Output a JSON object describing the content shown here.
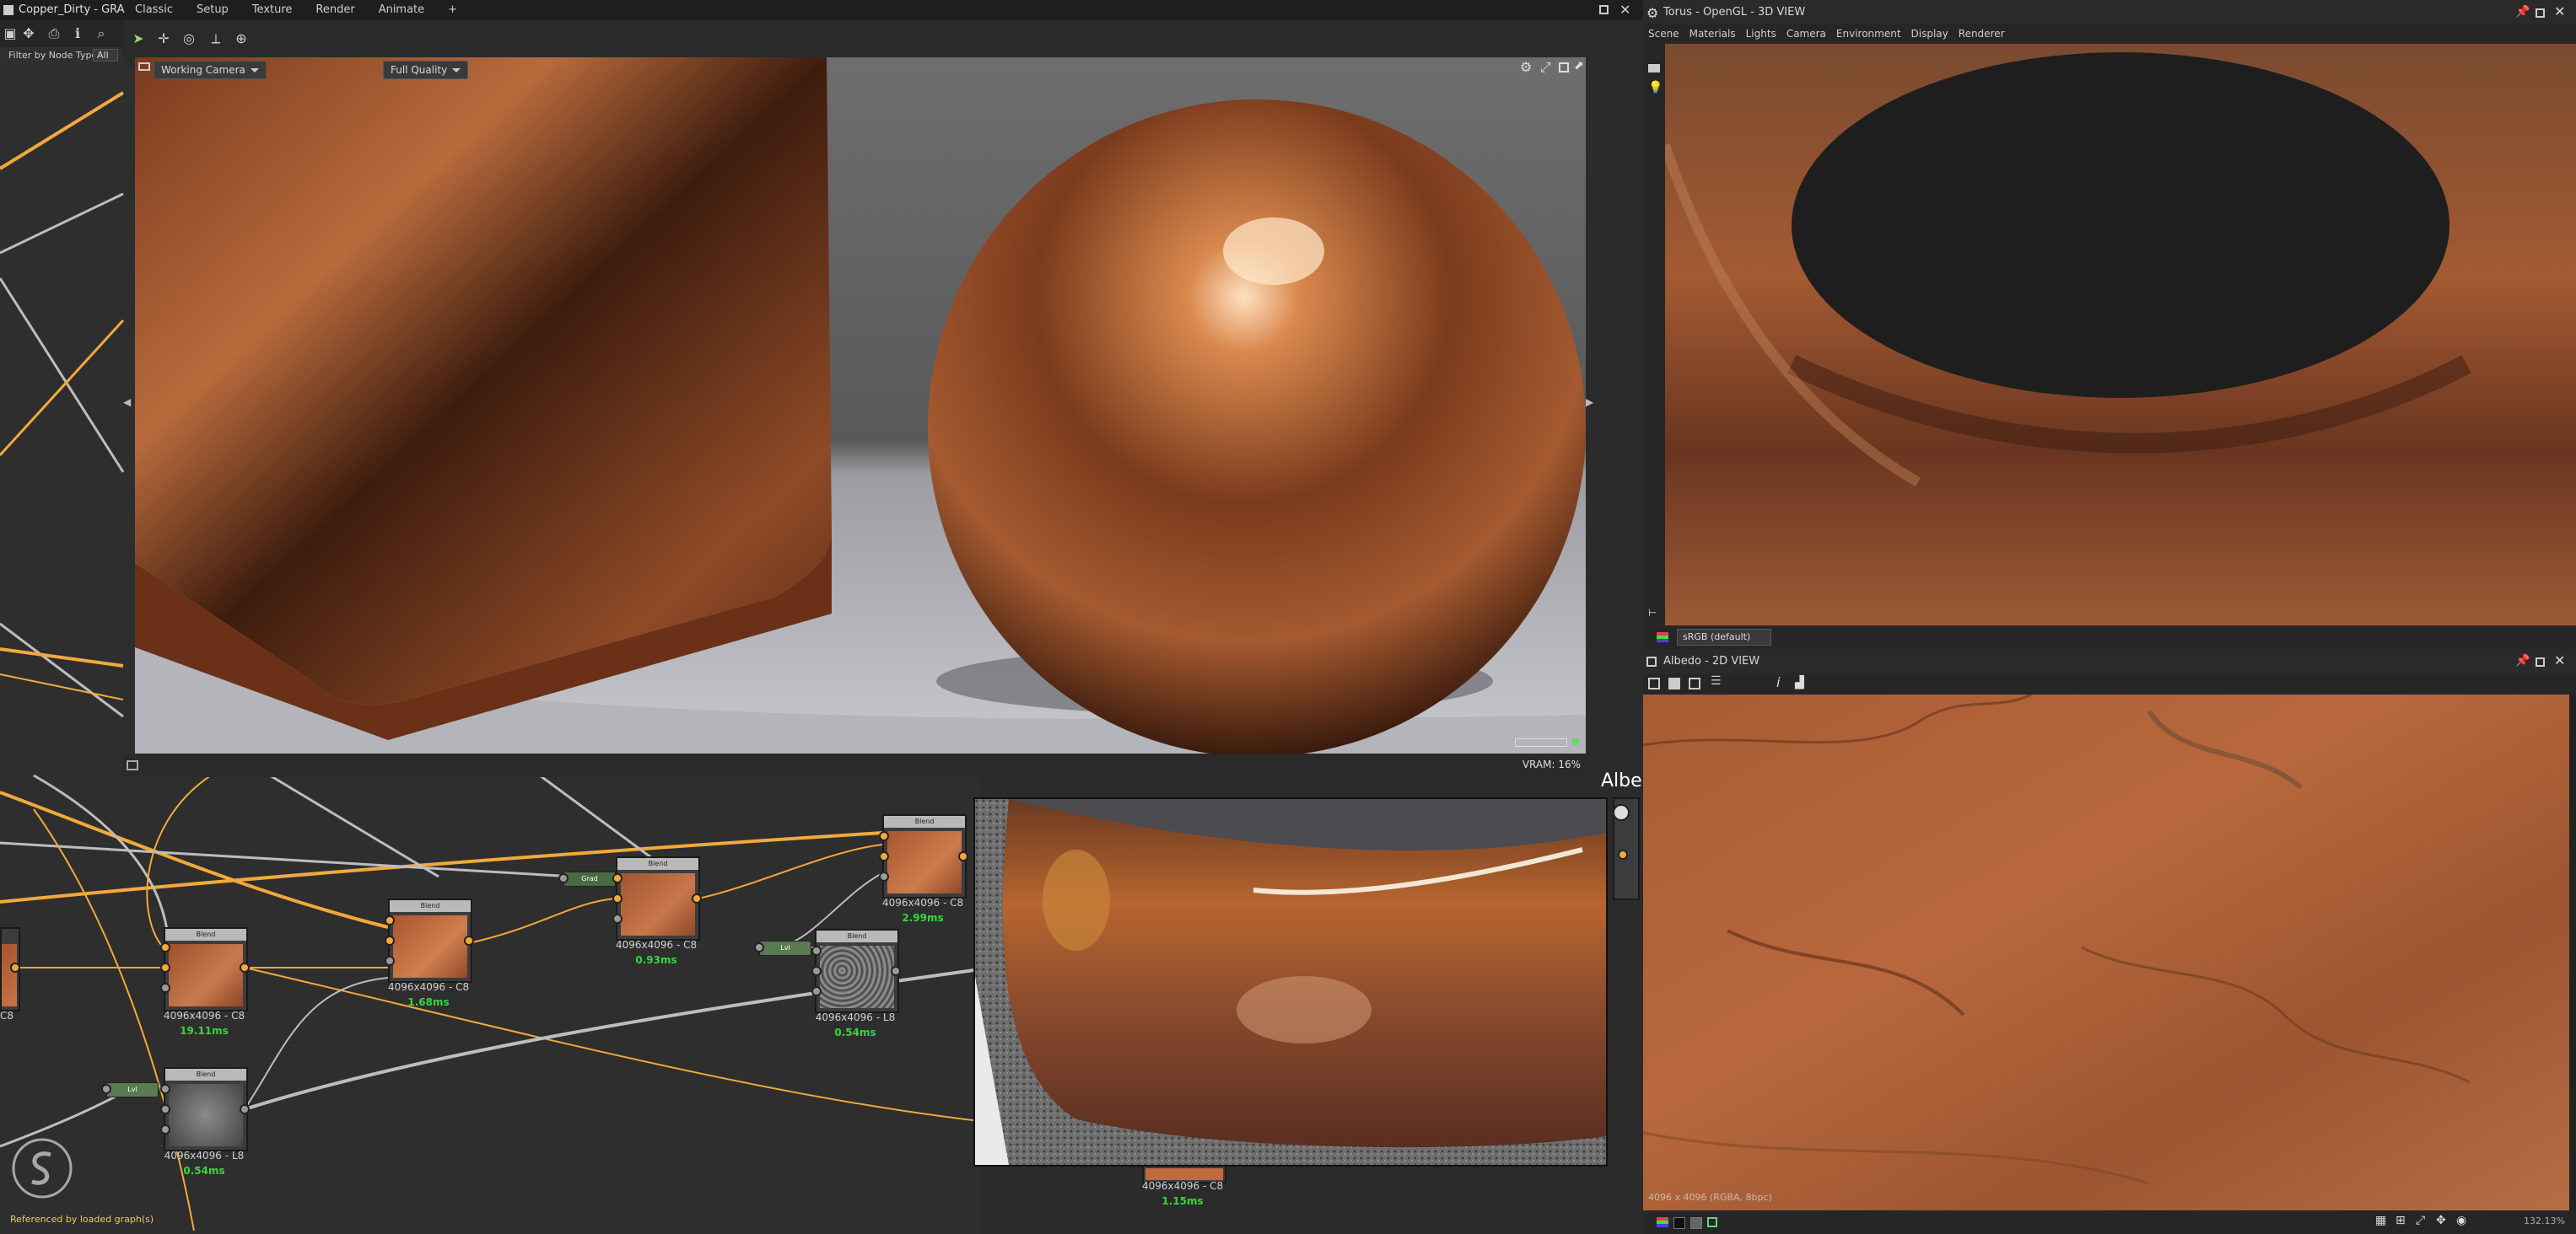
{
  "app": {
    "graph_title": "Copper_Dirty - GRA",
    "menu": [
      "Classic",
      "Setup",
      "Texture",
      "Render",
      "Animate",
      "+"
    ]
  },
  "graph_panel": {
    "filter_label": "Filter by Node Type",
    "filter_value": "All",
    "footer_text": "Referenced by loaded graph(s)",
    "floating_label": "Albe",
    "nodes": [
      {
        "title": "Blend",
        "size_label": "4096x4096 - C8",
        "time": "19.11ms"
      },
      {
        "title": "Blend",
        "size_label": "4096x4096 - C8",
        "time": "1.68ms"
      },
      {
        "title": "Blend",
        "size_label": "4096x4096 - C8",
        "time": "0.93ms"
      },
      {
        "title": "Blend",
        "size_label": "4096x4096 - C8",
        "time": "2.99ms"
      },
      {
        "title": "Blend",
        "size_label": "4096x4096 - L8",
        "time": "0.54ms"
      },
      {
        "title": "Blend",
        "size_label": "4096x4096 - L8",
        "time": "0.54ms"
      },
      {
        "title": "",
        "size_label": "4096x4096 - C8",
        "time": "1.15ms"
      }
    ],
    "partial_left_label": "C8",
    "tags": [
      "Grad",
      "Lvl",
      "Lvl"
    ]
  },
  "viewport": {
    "camera_select": "Working Camera",
    "quality_select": "Full Quality",
    "vram": "VRAM: 16%"
  },
  "view3d": {
    "title": "Torus - OpenGL - 3D VIEW",
    "menu": [
      "Scene",
      "Materials",
      "Lights",
      "Camera",
      "Environment",
      "Display",
      "Renderer"
    ],
    "colorspace": "sRGB (default)"
  },
  "view2d": {
    "title": "Albedo - 2D VIEW",
    "info": "4096 x 4096 (RGBA, 8bpc)",
    "zoom": "132.13%"
  },
  "colors": {
    "accent_orange": "#f2a93b",
    "time_green": "#35d83a",
    "copper": "#b0623a"
  }
}
